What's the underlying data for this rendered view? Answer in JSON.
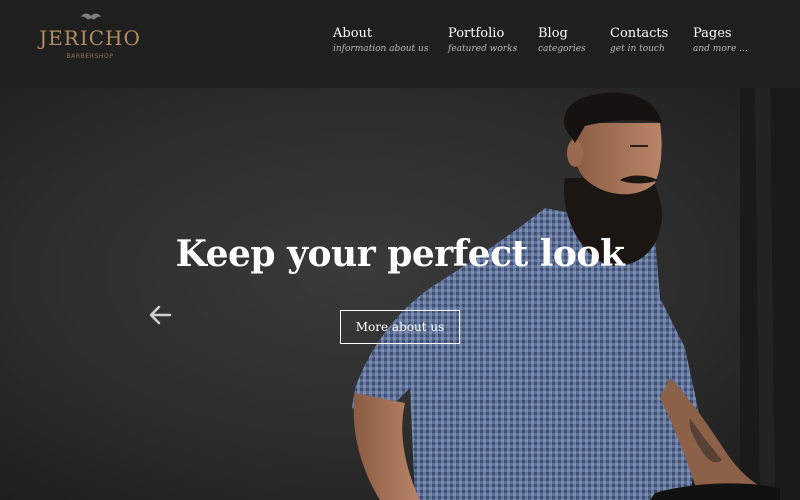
{
  "brand": {
    "name": "JERICHO",
    "tagline": "BARBERSHOP",
    "logo_icon": "mustache-icon",
    "accent": "#b58c5e"
  },
  "nav": {
    "items": [
      {
        "title": "About",
        "desc": "information about us"
      },
      {
        "title": "Portfolio",
        "desc": "featured works"
      },
      {
        "title": "Blog",
        "desc": "categories"
      },
      {
        "title": "Contacts",
        "desc": "get in touch"
      },
      {
        "title": "Pages",
        "desc": "and more ..."
      }
    ]
  },
  "hero": {
    "headline": "Keep your perfect look",
    "cta_label": "More about us",
    "prev_icon": "arrow-left-icon"
  },
  "colors": {
    "header_bg": "#1f1f1f",
    "hero_bg": "#2b2b2b",
    "text": "#ffffff"
  }
}
